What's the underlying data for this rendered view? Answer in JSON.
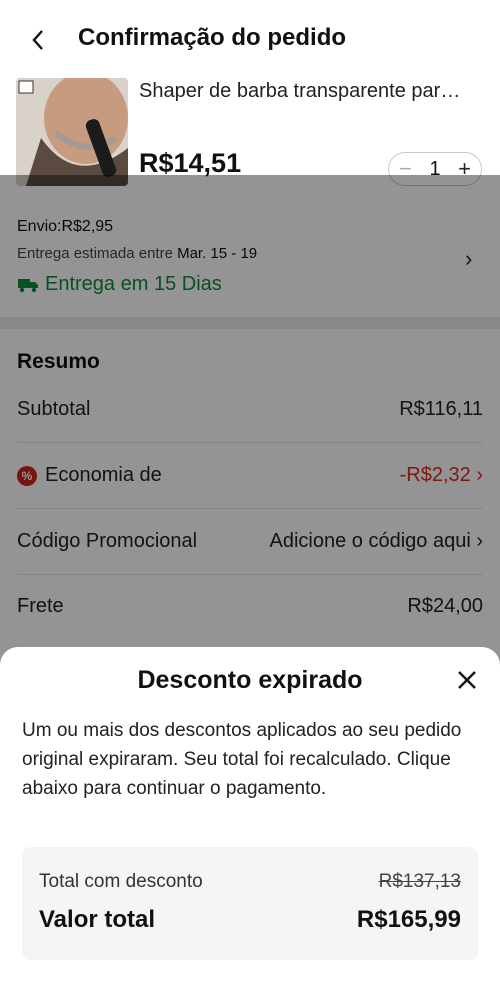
{
  "header": {
    "title": "Confirmação do pedido"
  },
  "product": {
    "name": "Shaper de barba transparente par…",
    "price": "R$14,51",
    "quantity": "1"
  },
  "shipping": {
    "label": "Envio:R$2,95",
    "estimate_prefix": "Entrega estimada entre ",
    "estimate_dates": "Mar. 15 - 19",
    "fast_label": "Entrega em 15 Dias"
  },
  "summary": {
    "title": "Resumo",
    "subtotal_label": "Subtotal",
    "subtotal_value": "R$116,11",
    "savings_label": "Economia de",
    "savings_value": "-R$2,32",
    "promo_label": "Código Promocional",
    "promo_value": "Adicione o código aqui",
    "freight_label": "Frete",
    "freight_value": "R$24,00"
  },
  "modal": {
    "title": "Desconto expirado",
    "message": "Um ou mais dos descontos aplicados ao seu pedido original expiraram. Seu total foi recalculado. Clique abaixo para continuar o pagamento.",
    "discount_total_label": "Total com desconto",
    "discount_total_value": "R$137,13",
    "total_label": "Valor total",
    "total_value": "R$165,99"
  },
  "colors": {
    "green": "#118a3c",
    "red": "#d62e1f"
  }
}
